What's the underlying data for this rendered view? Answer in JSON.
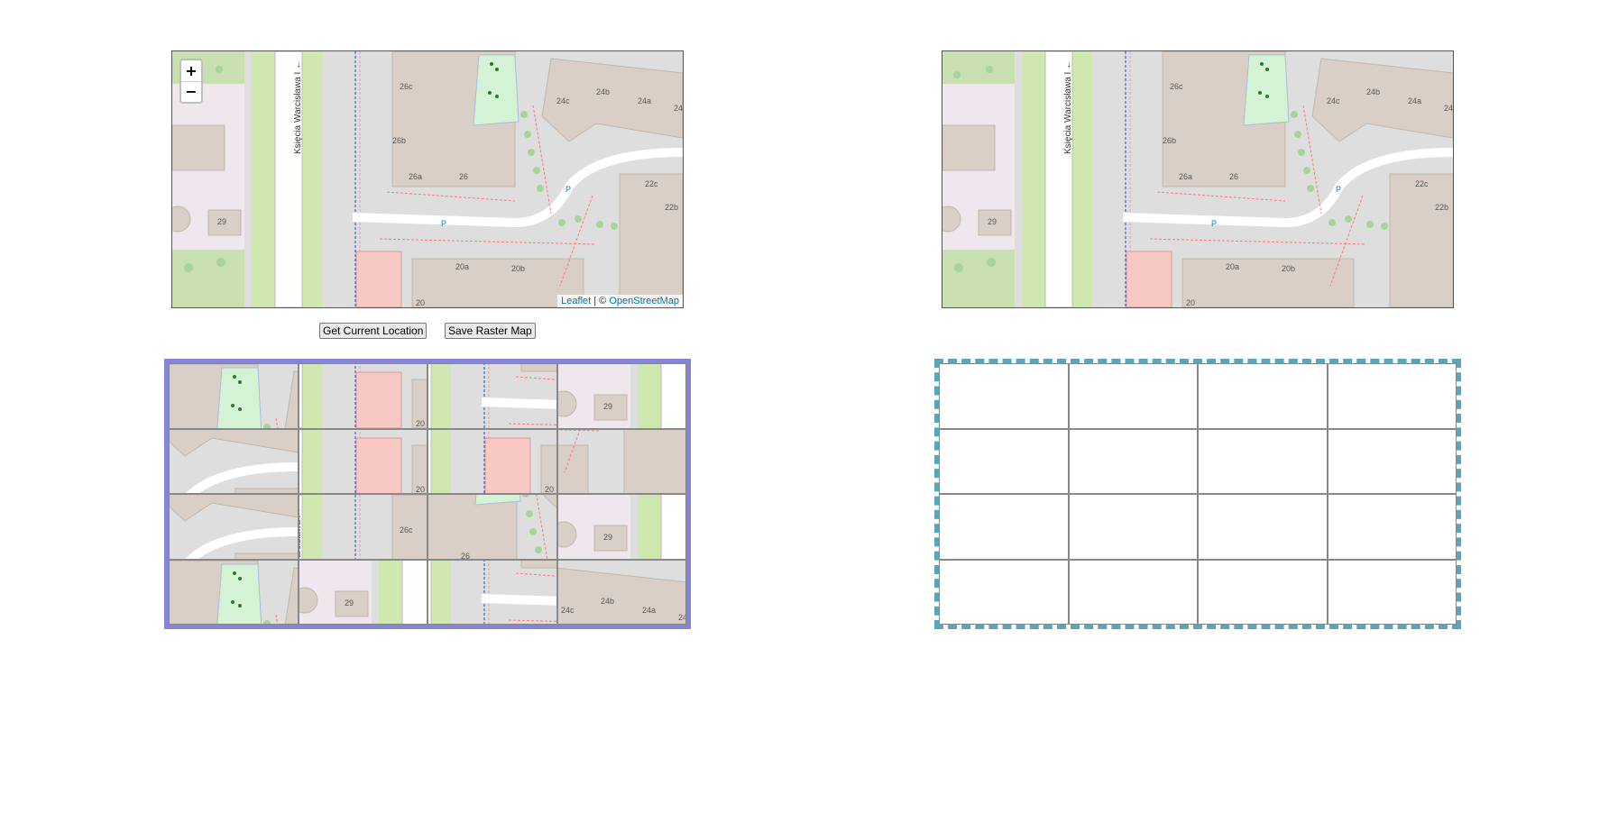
{
  "map": {
    "zoom_in": "+",
    "zoom_out": "−",
    "attribution_leaflet": "Leaflet",
    "attribution_sep": " | © ",
    "attribution_osm": "OpenStreetMap",
    "street": "Księcia Warcisława I",
    "parking": "P",
    "labels": [
      "26c",
      "26b",
      "26a",
      "26",
      "24c",
      "24b",
      "24a",
      "24",
      "22c",
      "22b",
      "20a",
      "20b",
      "20",
      "29"
    ]
  },
  "controls": {
    "get_location": "Get Current Location",
    "save_raster": "Save Raster Map"
  },
  "colors": {
    "puzzle_border": "#8585d8",
    "target_border": "#56a6c0"
  }
}
